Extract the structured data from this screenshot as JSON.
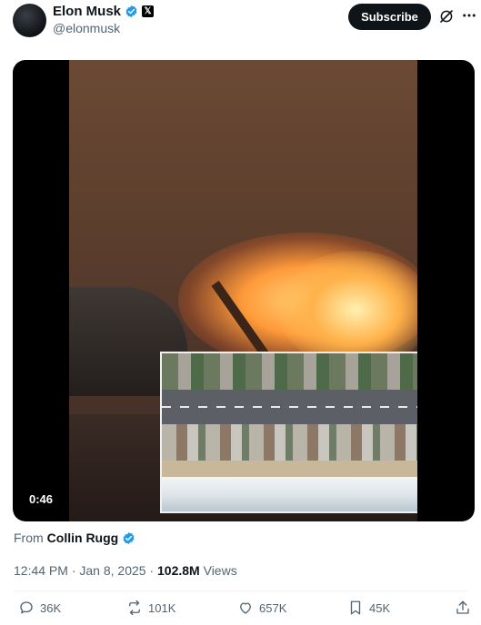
{
  "author": {
    "name": "Elon Musk",
    "handle": "@elonmusk",
    "verified_color": "#1d9bf0"
  },
  "header": {
    "subscribe_label": "Subscribe",
    "grok_icon": "grok-icon",
    "more_icon": "more-icon"
  },
  "media": {
    "duration": "0:46"
  },
  "source": {
    "from_label": "From",
    "name": "Collin Rugg"
  },
  "meta": {
    "time": "12:44 PM",
    "separator": "·",
    "date": "Jan 8, 2025",
    "views_count": "102.8M",
    "views_label": "Views"
  },
  "actions": {
    "replies": "36K",
    "reposts": "101K",
    "likes": "657K",
    "bookmarks": "45K"
  }
}
